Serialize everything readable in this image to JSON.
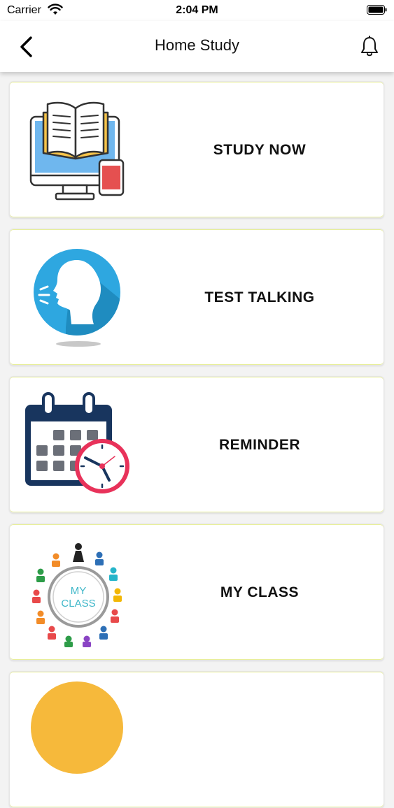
{
  "status_bar": {
    "carrier": "Carrier",
    "time": "2:04 PM",
    "wifi_icon": "wifi-icon",
    "battery_icon": "battery-icon"
  },
  "nav": {
    "title": "Home Study",
    "back_icon": "chevron-left-icon",
    "bell_icon": "bell-icon"
  },
  "menu": {
    "items": [
      {
        "label": "STUDY NOW",
        "icon": "computer-book-icon"
      },
      {
        "label": "TEST TALKING",
        "icon": "speaking-head-icon"
      },
      {
        "label": "REMINDER",
        "icon": "calendar-clock-icon"
      },
      {
        "label": "MY CLASS",
        "icon": "my-class-icon",
        "icon_text": [
          "MY",
          "CLASS"
        ]
      }
    ]
  },
  "colors": {
    "background": "#f3f3f3",
    "card": "#ffffff",
    "card_edge": "#e8ef9a",
    "text": "#111111",
    "accent_blue": "#2ea7e0",
    "calendar_navy": "#18355e",
    "clock_red": "#e8325a"
  }
}
